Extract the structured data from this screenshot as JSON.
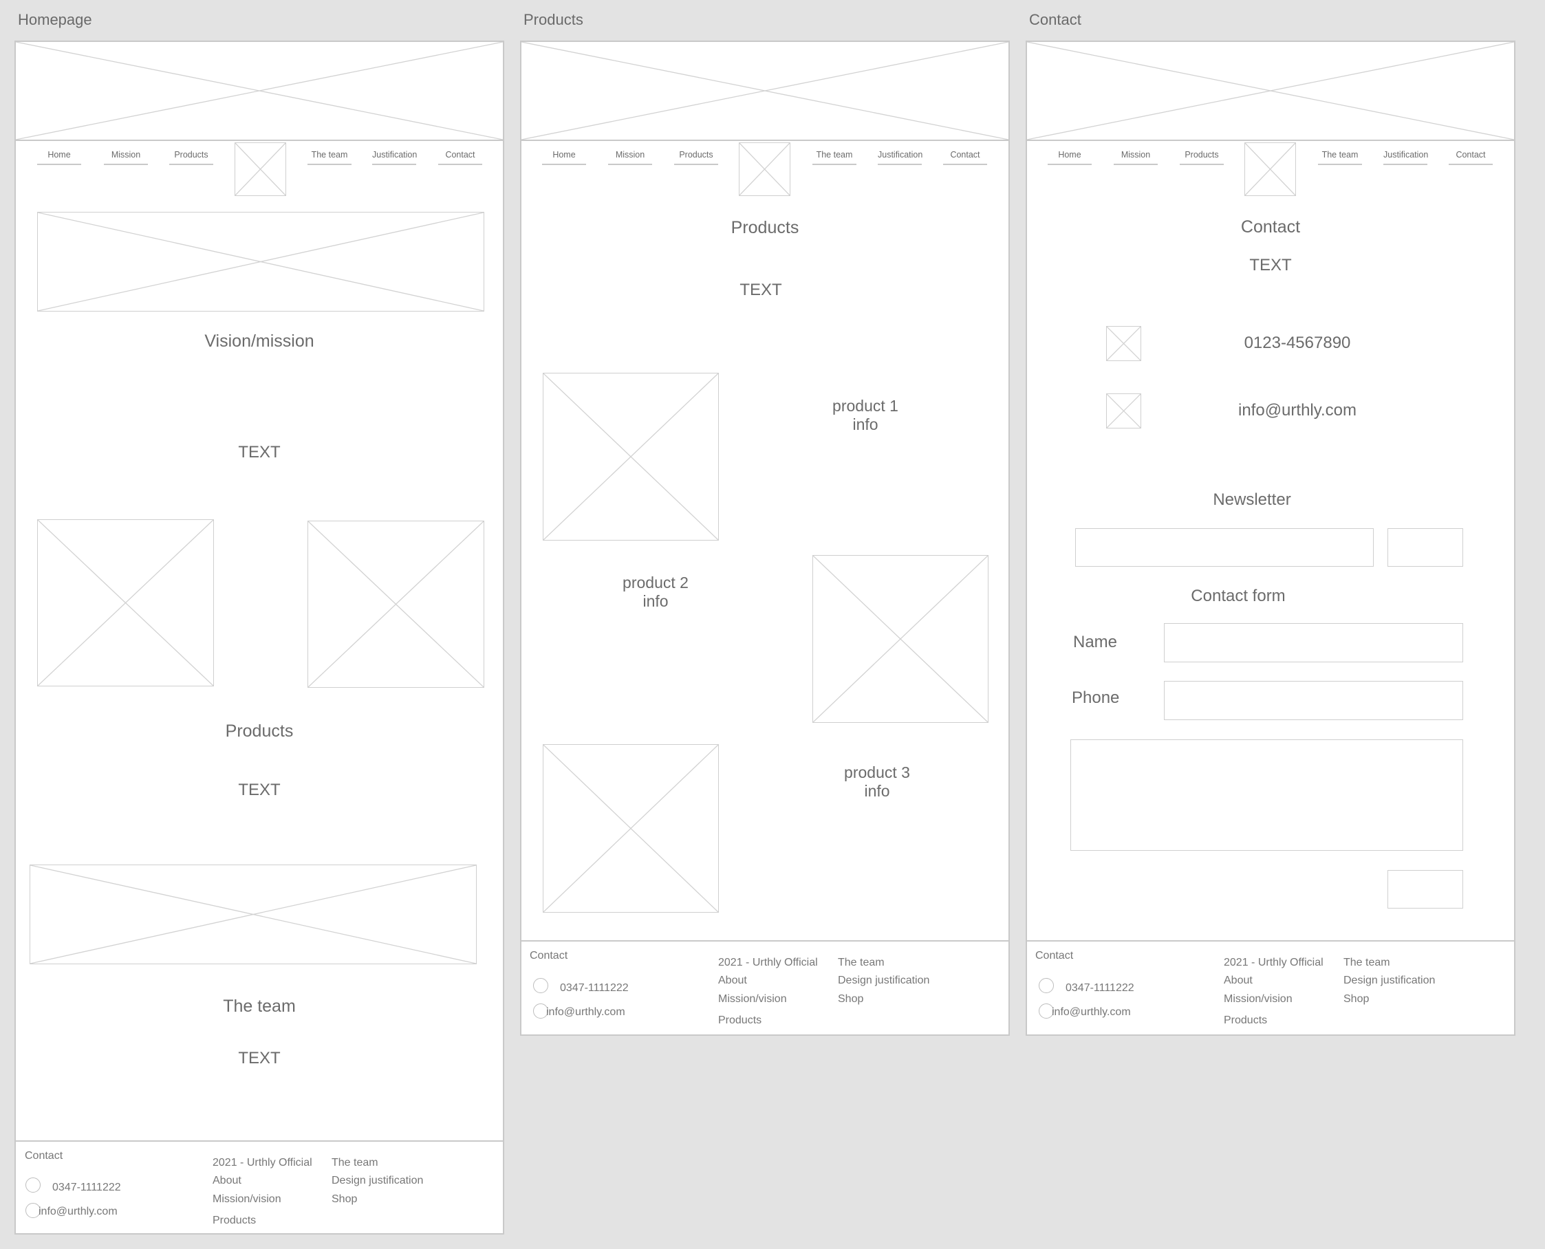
{
  "frames": {
    "homepage": {
      "title": "Homepage",
      "vision_heading": "Vision/mission",
      "vision_text": "TEXT",
      "products_heading": "Products",
      "products_text": "TEXT",
      "team_heading": "The team",
      "team_text": "TEXT"
    },
    "products": {
      "title": "Products",
      "heading": "Products",
      "text": "TEXT",
      "product1": {
        "line1": "product 1",
        "line2": "info"
      },
      "product2": {
        "line1": "product 2",
        "line2": "info"
      },
      "product3": {
        "line1": "product 3",
        "line2": "info"
      }
    },
    "contact": {
      "title": "Contact",
      "heading": "Contact",
      "text": "TEXT",
      "phone": "0123-4567890",
      "email": "info@urthly.com",
      "newsletter_heading": "Newsletter",
      "newsletter_input_value": "",
      "contact_form_heading": "Contact form",
      "name_label": "Name",
      "phone_label": "Phone",
      "name_value": "",
      "phone_value": "",
      "message_value": ""
    }
  },
  "nav": {
    "items": [
      "Home",
      "Mission",
      "Products",
      "The team",
      "Justification",
      "Contact"
    ]
  },
  "footer": {
    "contact_label": "Contact",
    "phone": "0347-1111222",
    "email": "info@urthly.com",
    "col1": [
      "2021 - Urthly Official",
      "About",
      "Mission/vision",
      "Products"
    ],
    "col2": [
      "The team",
      "Design justification",
      "Shop"
    ]
  },
  "colors": {
    "canvas": "#e3e3e3",
    "frame_border": "#c9c9c9",
    "placeholder_line": "#d2d2d2",
    "text": "#6b6b6b"
  }
}
